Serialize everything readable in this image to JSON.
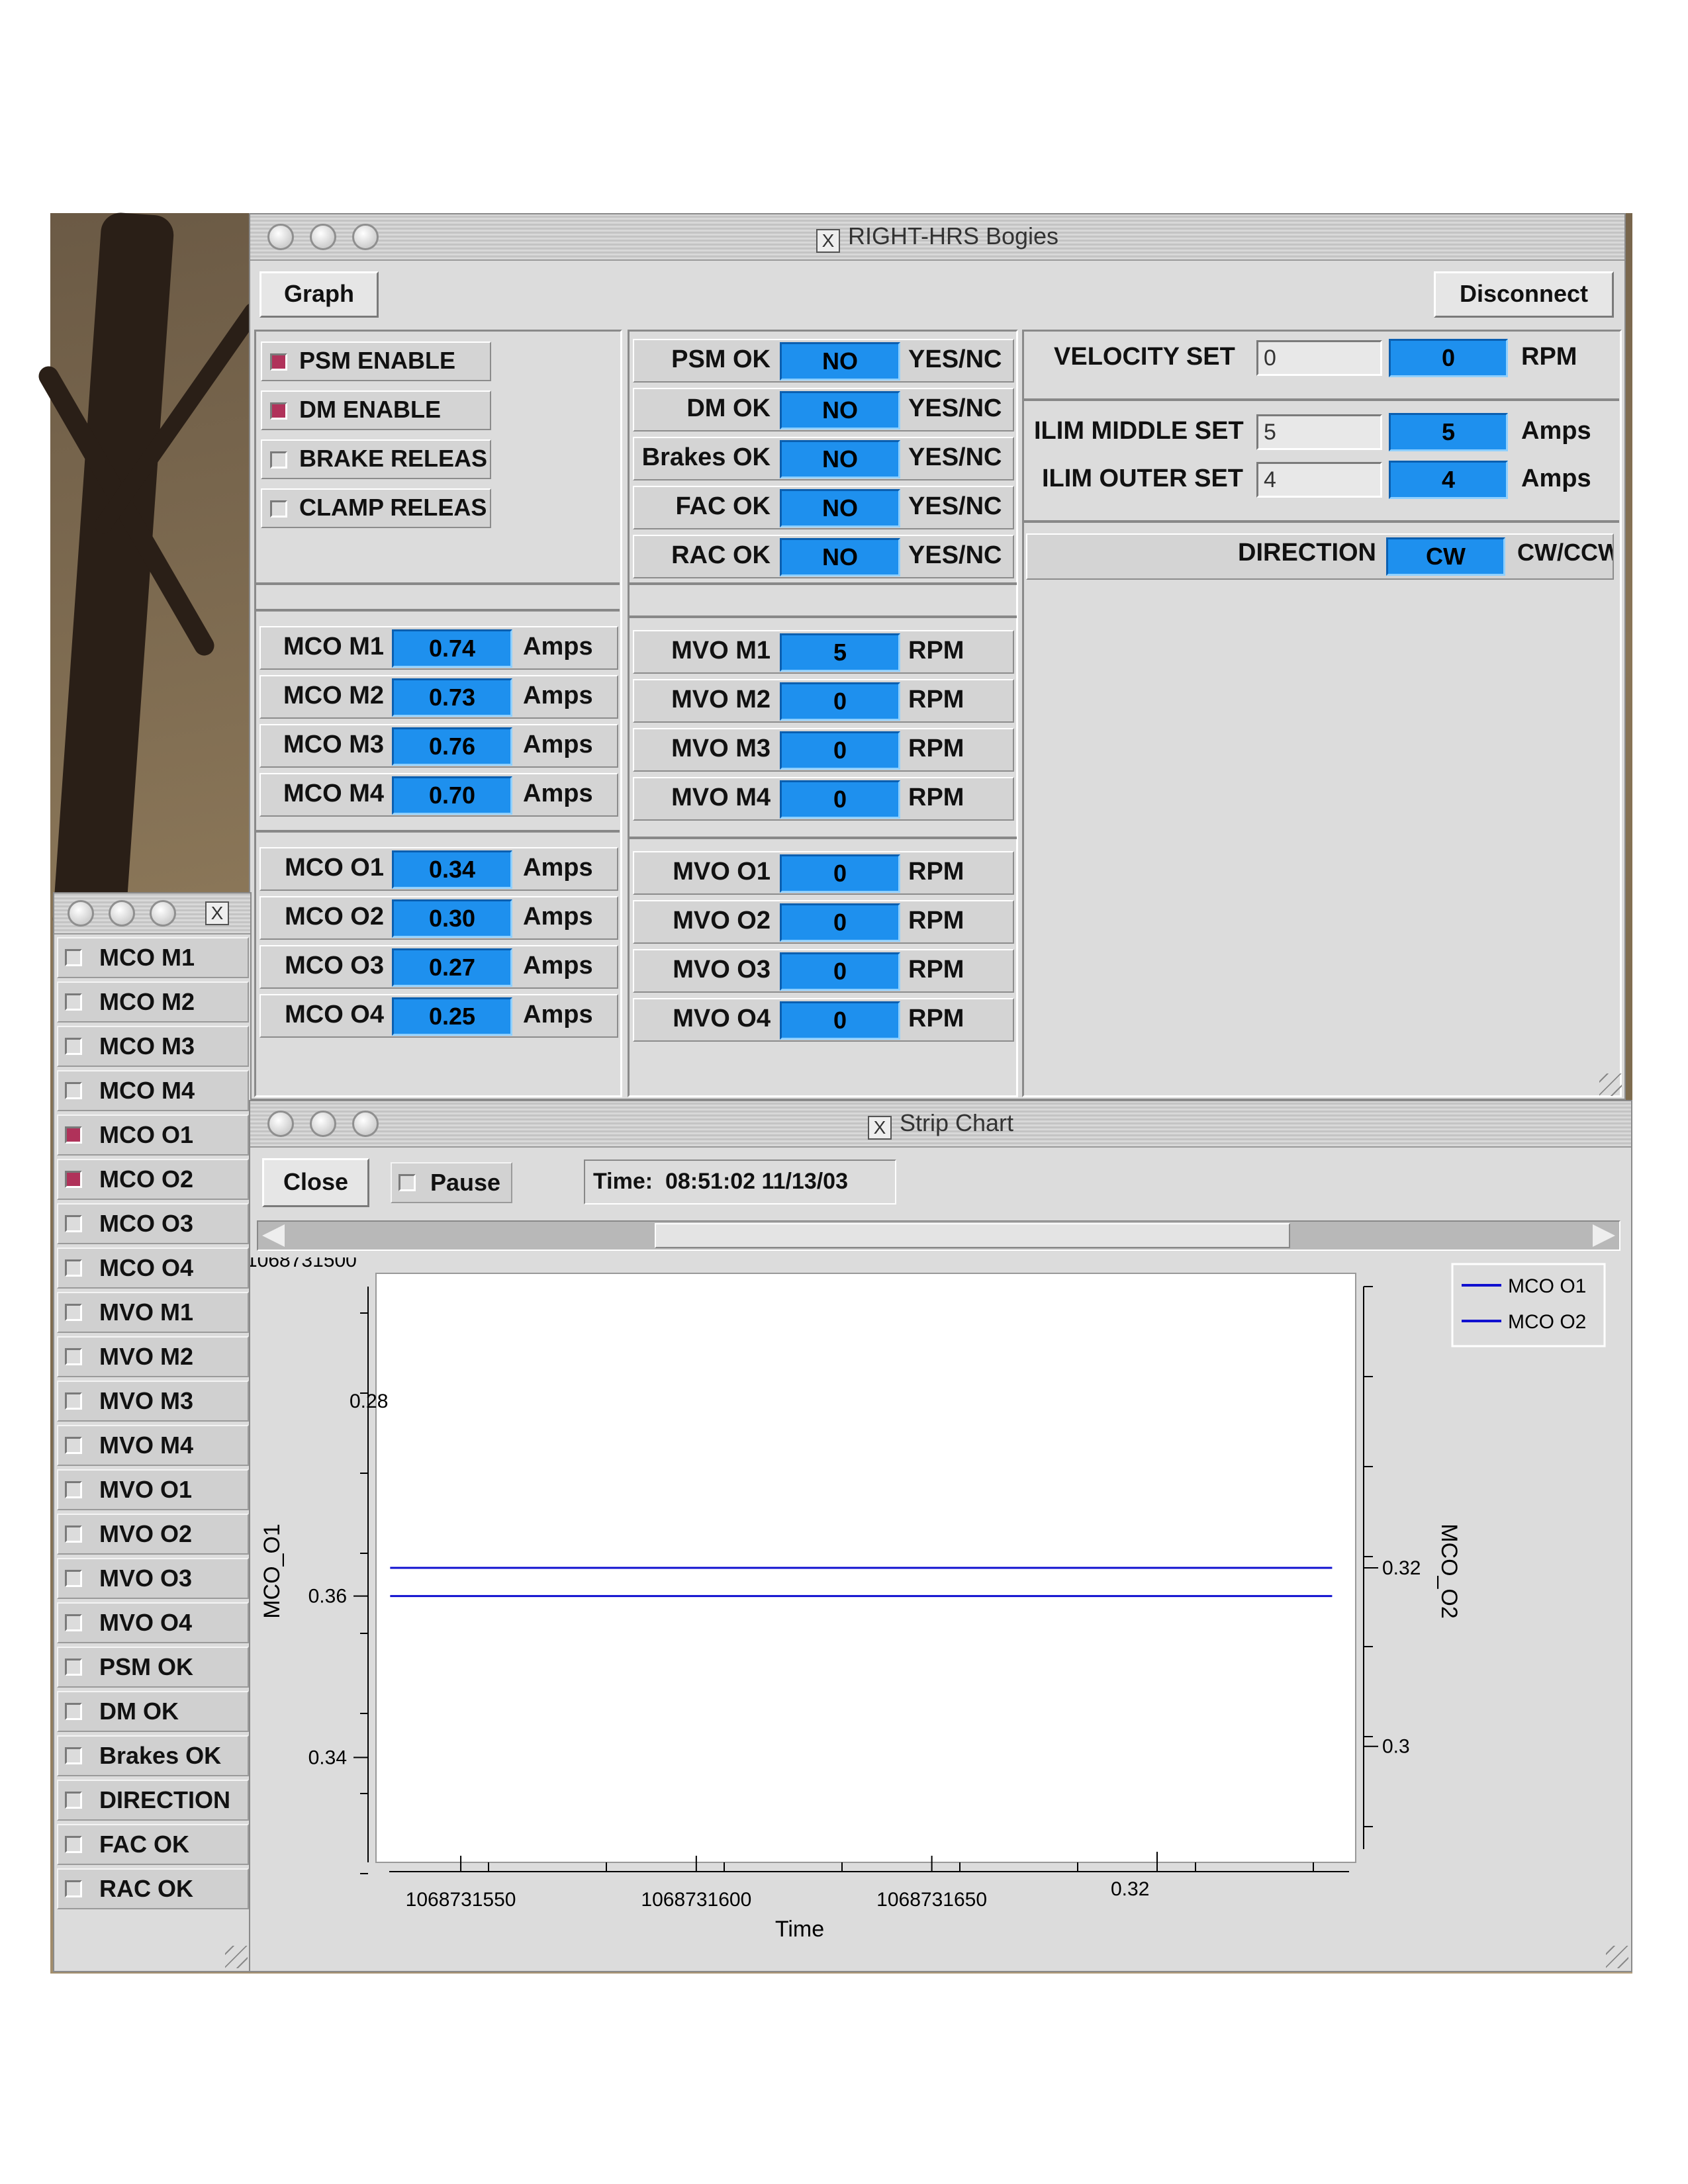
{
  "main_window": {
    "title": "RIGHT-HRS Bogies",
    "graph_button": "Graph",
    "disconnect_button": "Disconnect",
    "enables": [
      {
        "label": "PSM ENABLE",
        "checked": true
      },
      {
        "label": "DM ENABLE",
        "checked": true
      },
      {
        "label": "BRAKE RELEAS",
        "checked": false
      },
      {
        "label": "CLAMP RELEAS",
        "checked": false
      }
    ],
    "status": [
      {
        "label": "PSM OK",
        "value": "NO",
        "unit": "YES/NC"
      },
      {
        "label": "DM OK",
        "value": "NO",
        "unit": "YES/NC"
      },
      {
        "label": "Brakes OK",
        "value": "NO",
        "unit": "YES/NC"
      },
      {
        "label": "FAC OK",
        "value": "NO",
        "unit": "YES/NC"
      },
      {
        "label": "RAC OK",
        "value": "NO",
        "unit": "YES/NC"
      }
    ],
    "mco_middle": [
      {
        "label": "MCO M1",
        "value": "0.74",
        "unit": "Amps"
      },
      {
        "label": "MCO M2",
        "value": "0.73",
        "unit": "Amps"
      },
      {
        "label": "MCO M3",
        "value": "0.76",
        "unit": "Amps"
      },
      {
        "label": "MCO M4",
        "value": "0.70",
        "unit": "Amps"
      }
    ],
    "mco_outer": [
      {
        "label": "MCO O1",
        "value": "0.34",
        "unit": "Amps"
      },
      {
        "label": "MCO O2",
        "value": "0.30",
        "unit": "Amps"
      },
      {
        "label": "MCO O3",
        "value": "0.27",
        "unit": "Amps"
      },
      {
        "label": "MCO O4",
        "value": "0.25",
        "unit": "Amps"
      }
    ],
    "mvo_middle": [
      {
        "label": "MVO M1",
        "value": "5",
        "unit": "RPM"
      },
      {
        "label": "MVO M2",
        "value": "0",
        "unit": "RPM"
      },
      {
        "label": "MVO M3",
        "value": "0",
        "unit": "RPM"
      },
      {
        "label": "MVO M4",
        "value": "0",
        "unit": "RPM"
      }
    ],
    "mvo_outer": [
      {
        "label": "MVO O1",
        "value": "0",
        "unit": "RPM"
      },
      {
        "label": "MVO O2",
        "value": "0",
        "unit": "RPM"
      },
      {
        "label": "MVO O3",
        "value": "0",
        "unit": "RPM"
      },
      {
        "label": "MVO O4",
        "value": "0",
        "unit": "RPM"
      }
    ],
    "settings": {
      "velocity": {
        "label": "VELOCITY SET",
        "input": "0",
        "value": "0",
        "unit": "RPM"
      },
      "ilim_middle": {
        "label": "ILIM MIDDLE SET",
        "input": "5",
        "value": "5",
        "unit": "Amps"
      },
      "ilim_outer": {
        "label": "ILIM OUTER SET",
        "input": "4",
        "value": "4",
        "unit": "Amps"
      },
      "direction": {
        "label": "DIRECTION",
        "value": "CW",
        "unit": "CW/CCW"
      }
    }
  },
  "signal_list": {
    "items": [
      {
        "label": "MCO M1",
        "checked": false
      },
      {
        "label": "MCO M2",
        "checked": false
      },
      {
        "label": "MCO M3",
        "checked": false
      },
      {
        "label": "MCO M4",
        "checked": false
      },
      {
        "label": "MCO O1",
        "checked": true
      },
      {
        "label": "MCO O2",
        "checked": true
      },
      {
        "label": "MCO O3",
        "checked": false
      },
      {
        "label": "MCO O4",
        "checked": false
      },
      {
        "label": "MVO M1",
        "checked": false
      },
      {
        "label": "MVO M2",
        "checked": false
      },
      {
        "label": "MVO M3",
        "checked": false
      },
      {
        "label": "MVO M4",
        "checked": false
      },
      {
        "label": "MVO O1",
        "checked": false
      },
      {
        "label": "MVO O2",
        "checked": false
      },
      {
        "label": "MVO O3",
        "checked": false
      },
      {
        "label": "MVO O4",
        "checked": false
      },
      {
        "label": "PSM OK",
        "checked": false
      },
      {
        "label": "DM OK",
        "checked": false
      },
      {
        "label": "Brakes OK",
        "checked": false
      },
      {
        "label": "DIRECTION",
        "checked": false
      },
      {
        "label": "FAC OK",
        "checked": false
      },
      {
        "label": "RAC OK",
        "checked": false
      }
    ]
  },
  "strip_chart": {
    "title": "Strip Chart",
    "close_button": "Close",
    "pause_label": "Pause",
    "time_label": "Time:",
    "time_value": "08:51:02 11/13/03",
    "scrollbar_position": 0.58
  },
  "chart_data": {
    "type": "line",
    "xlabel": "Time",
    "ylabel_left": "MCO_O1",
    "ylabel_right": "MCO_O2",
    "x_ticks": [
      "1068731550",
      "1068731600",
      "1068731650"
    ],
    "x_tick_values": [
      1068731550,
      1068731600,
      1068731650
    ],
    "xlim": [
      1068731532,
      1068731740
    ],
    "left_ticks": [
      "0.36",
      "0.34"
    ],
    "left_tick_values": [
      0.36,
      0.34
    ],
    "left_ylim": [
      0.327,
      0.4
    ],
    "right_ticks": [
      "0.32",
      "0.3"
    ],
    "right_tick_values": [
      0.32,
      0.3
    ],
    "right_ylim": [
      0.287,
      0.353
    ],
    "artifact_labels": {
      "top_left": "1068731500",
      "overlap_left": "0.28",
      "bottom_right": "0.32"
    },
    "series": [
      {
        "name": "MCO O1",
        "axis": "left",
        "color": "#1010d0",
        "x": [
          1068731535,
          1068731735
        ],
        "y": [
          0.36,
          0.36
        ]
      },
      {
        "name": "MCO O2",
        "axis": "right",
        "color": "#1010d0",
        "x": [
          1068731535,
          1068731735
        ],
        "y": [
          0.32,
          0.32
        ]
      }
    ],
    "legend_position": "top-right",
    "grid": false
  }
}
